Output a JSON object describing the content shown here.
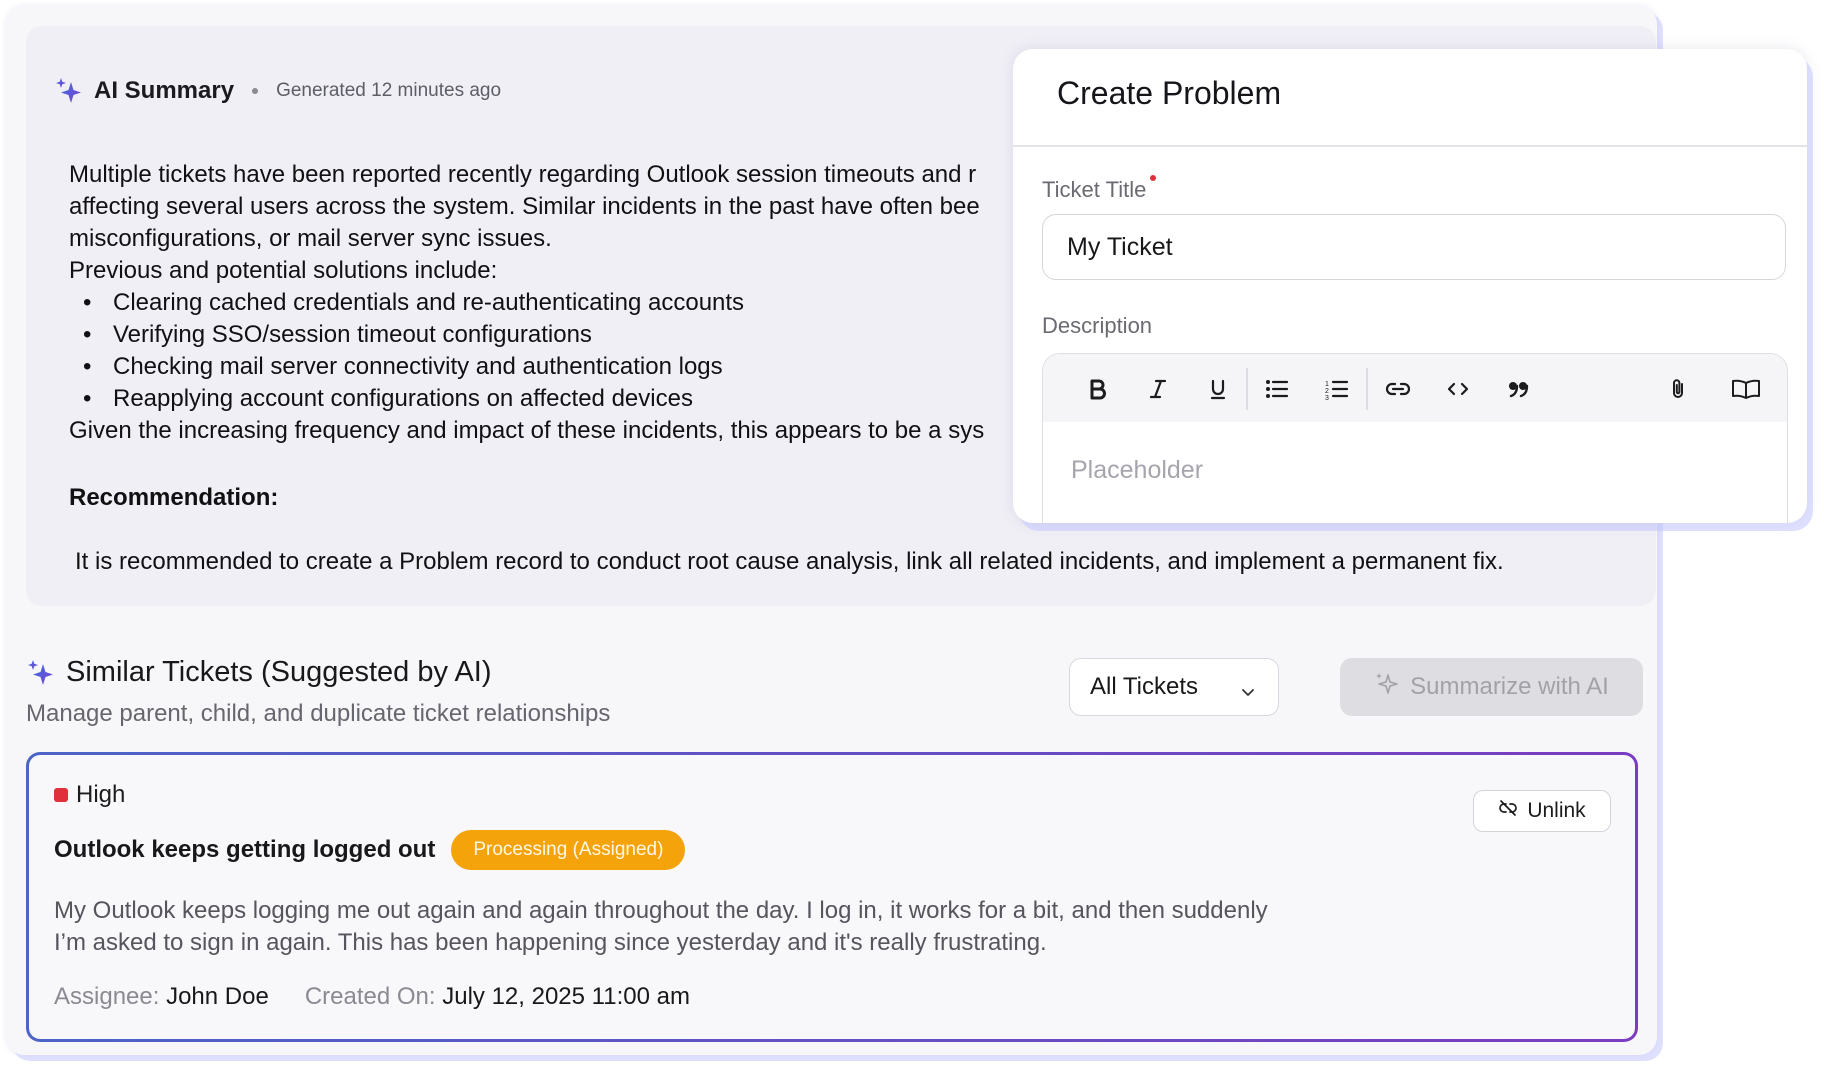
{
  "ai_summary": {
    "title": "AI Summary",
    "generated": "Generated 12 minutes ago",
    "line1": "Multiple tickets have been reported recently regarding Outlook session timeouts and r",
    "line2": "affecting several users across the system. Similar incidents in the past have often bee",
    "line3": "misconfigurations, or mail server sync issues.",
    "solutions_intro": "Previous and potential solutions include:",
    "solutions": [
      "Clearing cached credentials and re-authenticating accounts",
      "Verifying SSO/session timeout configurations",
      "Checking mail server connectivity and authentication logs",
      "Reapplying account configurations on affected devices"
    ],
    "closing": "Given the increasing frequency and impact of these incidents, this appears to be a sys",
    "recommendation_title": "Recommendation:",
    "recommendation_body": "It is recommended to create a Problem record to conduct root cause analysis, link all related incidents, and implement a permanent fix."
  },
  "similar": {
    "title": "Similar Tickets (Suggested by AI)",
    "subtitle": "Manage parent, child, and duplicate ticket relationships",
    "filter_value": "All Tickets",
    "summarize_label": "Summarize with AI"
  },
  "ticket": {
    "priority": "High",
    "title": "Outlook keeps getting logged out",
    "status": "Processing (Assigned)",
    "description_line1": "My Outlook keeps logging me out again and again throughout the day. I log in, it works for a bit, and then suddenly",
    "description_line2": "I’m asked to sign in again. This has been happening since yesterday and it's really frustrating.",
    "assignee_label": "Assignee:",
    "assignee": "John Doe",
    "created_label": "Created On:",
    "created_on": "July 12, 2025 11:00 am",
    "unlink_label": "Unlink"
  },
  "create_problem": {
    "title": "Create Problem",
    "ticket_title_label": "Ticket Title",
    "ticket_title_value": "My Ticket",
    "description_label": "Description",
    "placeholder": "Placeholder"
  },
  "colors": {
    "accent_sparkle": "#6a4fd8",
    "priority_high": "#e0313a",
    "status_badge": "#f5a30a",
    "card_border_start": "#4c64c6",
    "card_border_end": "#7b3cc0"
  },
  "icons": {
    "sparkle": "sparkle-icon",
    "chevron": "chevron-down-icon",
    "unlink": "unlink-icon",
    "bold": "bold-icon",
    "italic": "italic-icon",
    "underline": "underline-icon",
    "bullet_list": "bullet-list-icon",
    "numbered_list": "numbered-list-icon",
    "link": "link-icon",
    "code": "code-icon",
    "quote": "quote-icon",
    "attachment": "attachment-icon",
    "book": "book-icon"
  }
}
